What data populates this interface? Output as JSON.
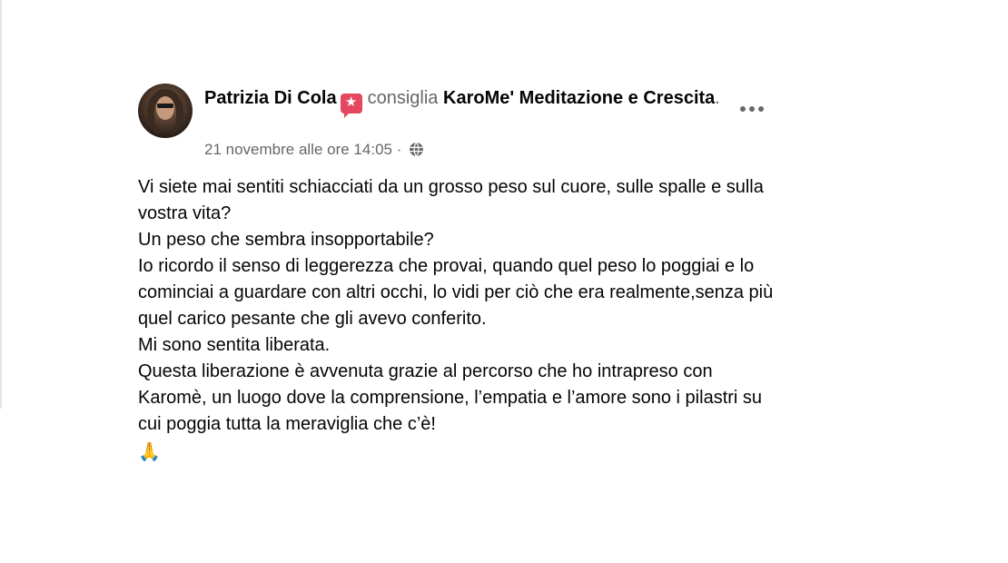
{
  "post": {
    "author": "Patrizia Di Cola",
    "verb": "consiglia",
    "page_name": "KaroMe' Meditazione e Crescita",
    "period": ".",
    "timestamp": "21 novembre alle ore 14:05",
    "separator": "·",
    "privacy_icon": "globe-icon",
    "badge_icon": "recommendation-star-icon",
    "body_lines": [
      "Vi siete mai sentiti schiacciati da un grosso peso sul cuore, sulle spalle e sulla vostra vita?",
      "Un peso che sembra insopportabile?",
      "Io ricordo il senso di leggerezza che provai, quando quel peso lo poggiai e lo cominciai a guardare con altri occhi, lo vidi per ciò che era realmente,senza più quel carico pesante che gli avevo conferito.",
      "Mi sono sentita liberata.",
      "Questa liberazione è avvenuta grazie al percorso che ho intrapreso con Karomè, un luogo dove la comprensione, l’empatia e l’amore sono i pilastri su cui poggia tutta la meraviglia che c’è!"
    ],
    "emoji": "🙏"
  },
  "colors": {
    "primary_text": "#050505",
    "secondary_text": "#65676b",
    "badge": "#e4475e"
  }
}
